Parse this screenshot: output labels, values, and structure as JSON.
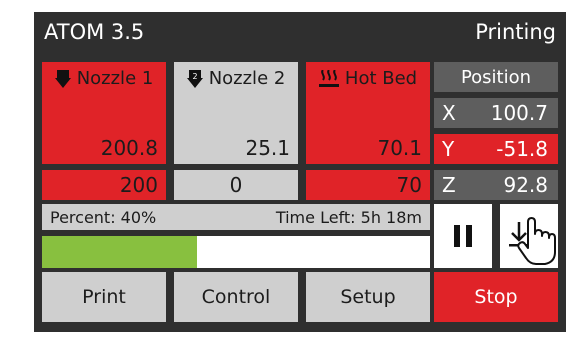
{
  "header": {
    "title": "ATOM 3.5",
    "status": "Printing"
  },
  "extruders": [
    {
      "label": "Nozzle 1",
      "current": "200.8",
      "target": "200",
      "icon": "nozzle-1-icon",
      "color": "#e02328"
    },
    {
      "label": "Nozzle 2",
      "current": "25.1",
      "target": "0",
      "icon": "nozzle-2-icon",
      "color": "#cfcfcf"
    }
  ],
  "hotbed": {
    "label": "Hot Bed",
    "current": "70.1",
    "target": "70",
    "icon": "heat-icon",
    "color": "#e02328"
  },
  "position": {
    "title": "Position",
    "axes": [
      {
        "axis": "X",
        "value": "100.7"
      },
      {
        "axis": "Y",
        "value": "-51.8"
      },
      {
        "axis": "Z",
        "value": "92.8"
      }
    ]
  },
  "progress": {
    "percent_label": "Percent: 40%",
    "time_left_label": "Time Left: 5h 18m",
    "fraction": 0.4
  },
  "controls": {
    "pause_icon": "pause-icon",
    "stop_icon": "download-icon"
  },
  "buttons": {
    "print": "Print",
    "control": "Control",
    "setup": "Setup",
    "stop": "Stop"
  },
  "colors": {
    "accent": "#e02328",
    "progress": "#88c03f",
    "panel": "#2f2f2f"
  }
}
